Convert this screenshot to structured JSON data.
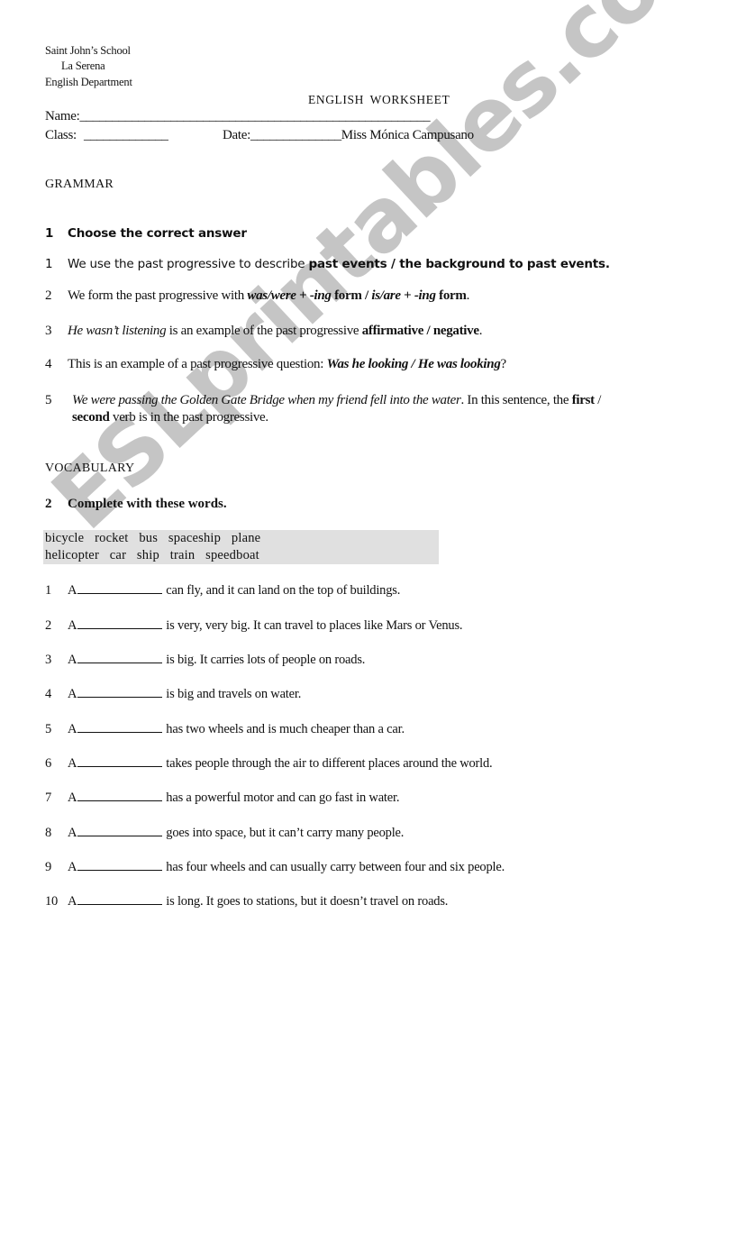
{
  "header": {
    "school_name": "Saint John’s School",
    "city": "La Serena",
    "department": "English Department",
    "worksheet_title": "ENGLISH  WORKSHEET",
    "name_label": "Name:",
    "name_blank": "______________________________________________________",
    "class_label": "Class:",
    "class_blank": "_____________",
    "date_label": "Date:",
    "date_blank": "______________",
    "teacher": "Miss Mónica Campusano"
  },
  "grammar": {
    "section_title": "GRAMMAR",
    "exercise_number": "1",
    "exercise_title": "Choose the correct answer",
    "items": [
      {
        "number": "1",
        "text_before": "We use the past progressive to describe ",
        "options_bold": "past events / the background to past events."
      },
      {
        "number": "2",
        "text_before": "We form the past progressive with ",
        "opt1_italic": "was/were",
        "opt1_rest": " + ",
        "opt1_ing": "-ing",
        "opt1_form": " form",
        "slash": " / ",
        "opt2_italic": "is/are",
        "opt2_rest": " + ",
        "opt2_ing": "-ing",
        "opt2_form": " form",
        "end": "."
      },
      {
        "number": "3",
        "italic_start": "He wasn’t listening",
        "text_middle": " is an example of the past progressive ",
        "options_bold": "affirmative / negative",
        "end": "."
      },
      {
        "number": "4",
        "text_before": "This is an example of a past progressive question: ",
        "options_bold_italic": "Was he looking / He was looking",
        "end": "?"
      },
      {
        "number": "5",
        "italic_start": "We were passing the Golden Gate Bridge when my friend fell into the water",
        "text_middle": ". In this sentence, the ",
        "opt1_bold": "first",
        "slash": " /",
        "opt2_bold": "second",
        "end": " verb is in the past progressive."
      }
    ]
  },
  "vocabulary": {
    "section_title": "VOCABULARY",
    "exercise_number": "2",
    "exercise_title": "Complete with these words.",
    "word_bank_line1": "bicycle  rocket  bus  spaceship  plane",
    "word_bank_line2": "helicopter  car  ship  train  speedboat",
    "word_bank": [
      "bicycle",
      "rocket",
      "bus",
      "spaceship",
      "plane",
      "helicopter",
      "car",
      "ship",
      "train",
      "speedboat"
    ],
    "article": "A",
    "items": [
      {
        "number": "1",
        "text": "can fly, and it can land on the top of buildings."
      },
      {
        "number": "2",
        "text": "is very, very big. It can travel to places like Mars or Venus."
      },
      {
        "number": "3",
        "text": "is big. It carries lots of people on roads."
      },
      {
        "number": "4",
        "text": "is big and travels on water."
      },
      {
        "number": "5",
        "text": "has two wheels and is much cheaper than a car."
      },
      {
        "number": "6",
        "text": "takes people through the air to different places around the world."
      },
      {
        "number": "7",
        "text": "has a powerful motor and can go fast in water."
      },
      {
        "number": "8",
        "text": "goes into space, but it can’t carry many people."
      },
      {
        "number": "9",
        "text": "has four wheels and can usually carry between four and six people."
      },
      {
        "number": "10",
        "text": "is long. It goes to stations, but it doesn’t travel on roads."
      }
    ]
  },
  "watermark": {
    "text": "ESLprintables.com",
    "color": "#c2c2c2"
  },
  "colors": {
    "word_bank_background": "#e0e0e0",
    "text": "#111111"
  }
}
